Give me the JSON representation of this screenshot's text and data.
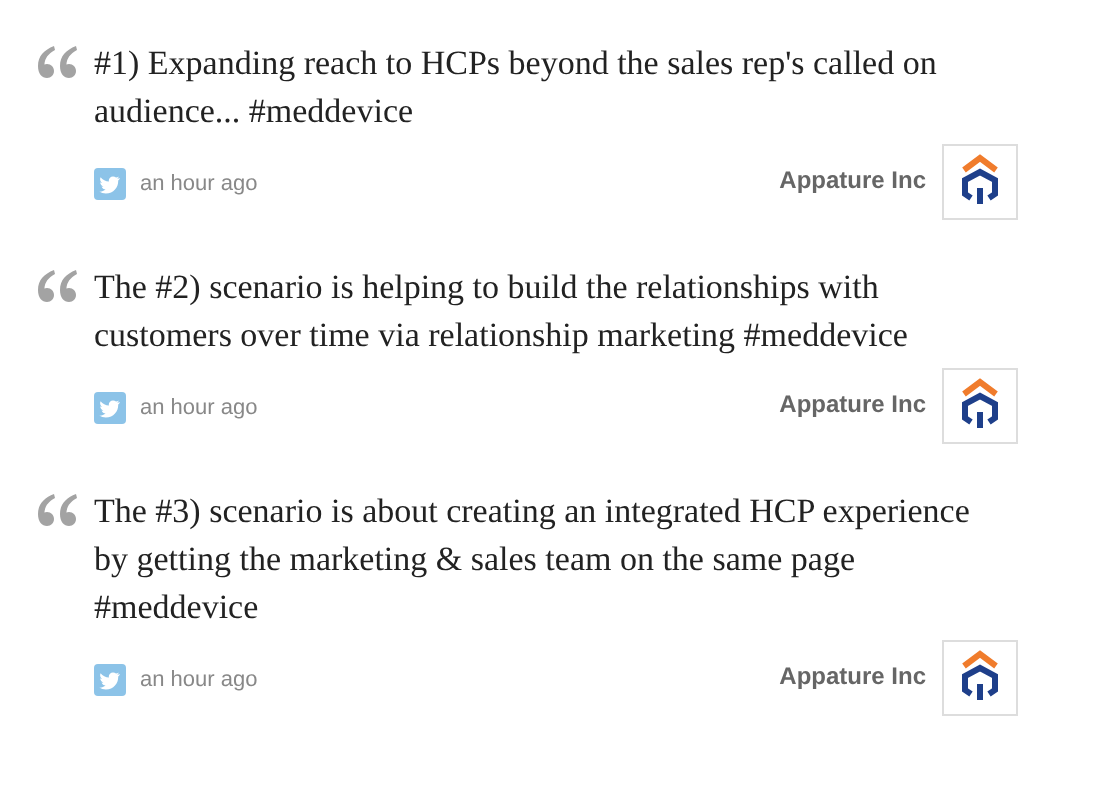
{
  "posts": [
    {
      "text": "#1) Expanding reach to HCPs beyond the sales rep's called on audience... #meddevice",
      "time": "an hour ago",
      "author": "Appature Inc"
    },
    {
      "text": "The #2) scenario is helping to build the relationships with customers over time via relationship marketing #meddevice",
      "time": "an hour ago",
      "author": "Appature Inc"
    },
    {
      "text": "The #3) scenario is about creating an integrated HCP experience by getting the marketing & sales team on the same page #meddevice",
      "time": "an hour ago",
      "author": "Appature Inc"
    }
  ]
}
